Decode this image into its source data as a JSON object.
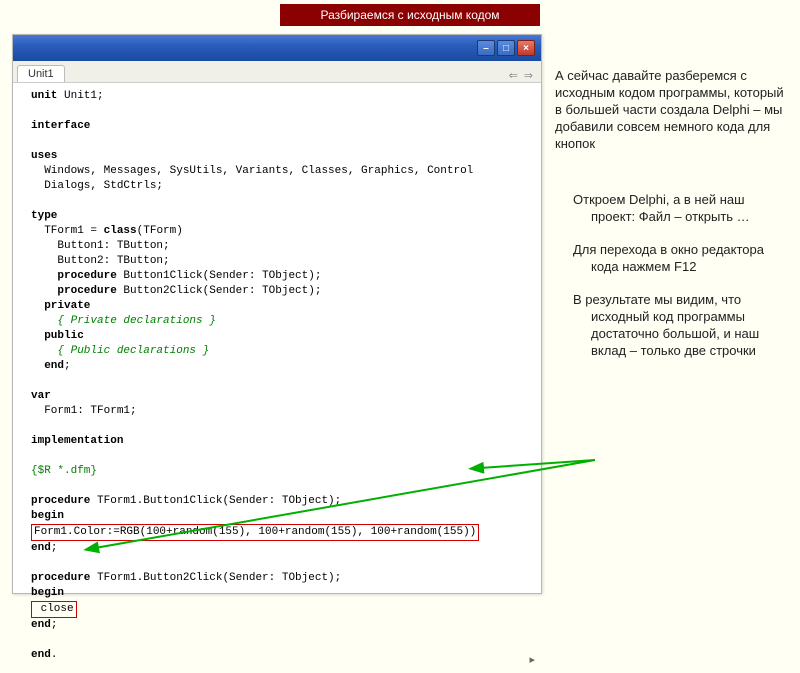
{
  "title": "Разбираемся с исходным кодом",
  "tab": "Unit1",
  "nav": {
    "back": "⇐",
    "fwd": "⇒"
  },
  "winbtn": {
    "min": "–",
    "max": "□",
    "close": "×"
  },
  "code": {
    "l1a": "unit",
    "l1b": " Unit1;",
    "l2": "interface",
    "l3": "uses",
    "l4": "  Windows, Messages, SysUtils, Variants, Classes, Graphics, Control",
    "l5": "  Dialogs, StdCtrls;",
    "l6": "type",
    "l7a": "  TForm1 = ",
    "l7b": "class",
    "l7c": "(TForm)",
    "l8": "    Button1: TButton;",
    "l9": "    Button2: TButton;",
    "l10a": "    ",
    "l10b": "procedure",
    "l10c": " Button1Click(Sender: TObject);",
    "l11a": "    ",
    "l11b": "procedure",
    "l11c": " Button2Click(Sender: TObject);",
    "l12a": "  ",
    "l12b": "private",
    "l13": "    { Private declarations }",
    "l14a": "  ",
    "l14b": "public",
    "l15": "    { Public declarations }",
    "l16a": "  ",
    "l16b": "end",
    "l16c": ";",
    "l17": "var",
    "l18": "  Form1: TForm1;",
    "l19": "implementation",
    "l20": "{$R *.dfm}",
    "l21a": "procedure",
    "l21b": " TForm1.Button1Click(Sender: TObject);",
    "l22": "begin",
    "l23": "Form1.Color:=RGB(100+random(155), 100+random(155), 100+random(155))",
    "l24a": "end",
    "l24b": ";",
    "l25a": "procedure",
    "l25b": " TForm1.Button2Click(Sender: TObject);",
    "l26": "begin",
    "l27": " close",
    "l28a": "end",
    "l28b": ";",
    "l29a": "end",
    "l29b": "."
  },
  "right": {
    "p1": " А сейчас давайте разберемся с исходным кодом программы, который в большей части создала Delphi – мы добавили совсем немного кода для кнопок",
    "p2": "Откроем  Delphi, а в ней наш проект: Файл – открыть …",
    "p3": "Для перехода в окно редактора кода нажмем F12",
    "p4": "В результате мы видим, что исходный код программы достаточно большой, и наш вклад – только две строчки"
  },
  "scroll_hint": "▸"
}
